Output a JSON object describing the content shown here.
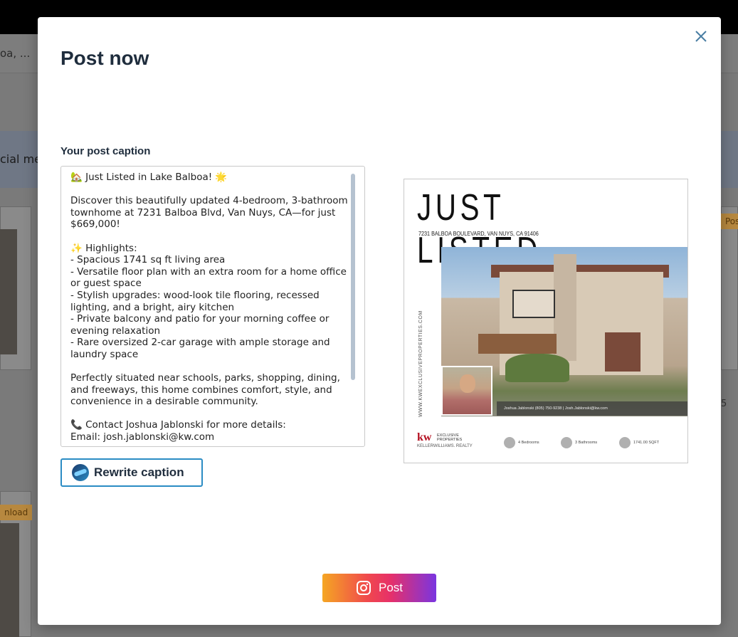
{
  "background": {
    "breadcrumb": "oa, ...",
    "banner_text": "cial me",
    "download_tag": "nload",
    "post_tag": "Post",
    "count": "5"
  },
  "modal": {
    "title": "Post now",
    "caption_label": "Your post caption",
    "caption_text": "🏡 Just Listed in Lake Balboa! 🌟\n\nDiscover this beautifully updated 4-bedroom, 3-bathroom townhome at 7231 Balboa Blvd, Van Nuys, CA—for just $669,000!\n\n✨ Highlights:\n- Spacious 1741 sq ft living area\n- Versatile floor plan with an extra room for a home office or guest space\n- Stylish upgrades: wood-look tile flooring, recessed lighting, and a bright, airy kitchen\n- Private balcony and patio for your morning coffee or evening relaxation\n- Rare oversized 2-car garage with ample storage and laundry space\n\nPerfectly situated near schools, parks, shopping, dining, and freeways, this home combines comfort, style, and convenience in a desirable community.\n\n📞 Contact Joshua Jablonski for more details:\nEmail: josh.jablonski@kw.com",
    "rewrite_label": "Rewrite caption",
    "post_label": "Post"
  },
  "flyer": {
    "title": "JUST LISTED",
    "address": "7231 BALBOA BOULEVARD, VAN NUYS, CA 91406",
    "website": "WWW.KWEXCLUSIVEPROPERTIES.COM",
    "agent_bar": "Joshua Jablonski (805) 750-9238 | Josh.Jablonski@kw.com",
    "logo": "kw",
    "logo_sub": "EXCLUSIVE PROPERTIES",
    "brokerage": "KELLERWILLIAMS. REALTY",
    "features": [
      {
        "label": "4 Bedrooms",
        "icon": "bed-icon"
      },
      {
        "label": "3 Bathrooms",
        "icon": "bath-icon"
      },
      {
        "label": "1741.00 SQFT",
        "icon": "area-icon"
      }
    ]
  },
  "colors": {
    "accent": "#2b8cc4",
    "title": "#1f2d3d",
    "kw_red": "#b40f20"
  }
}
